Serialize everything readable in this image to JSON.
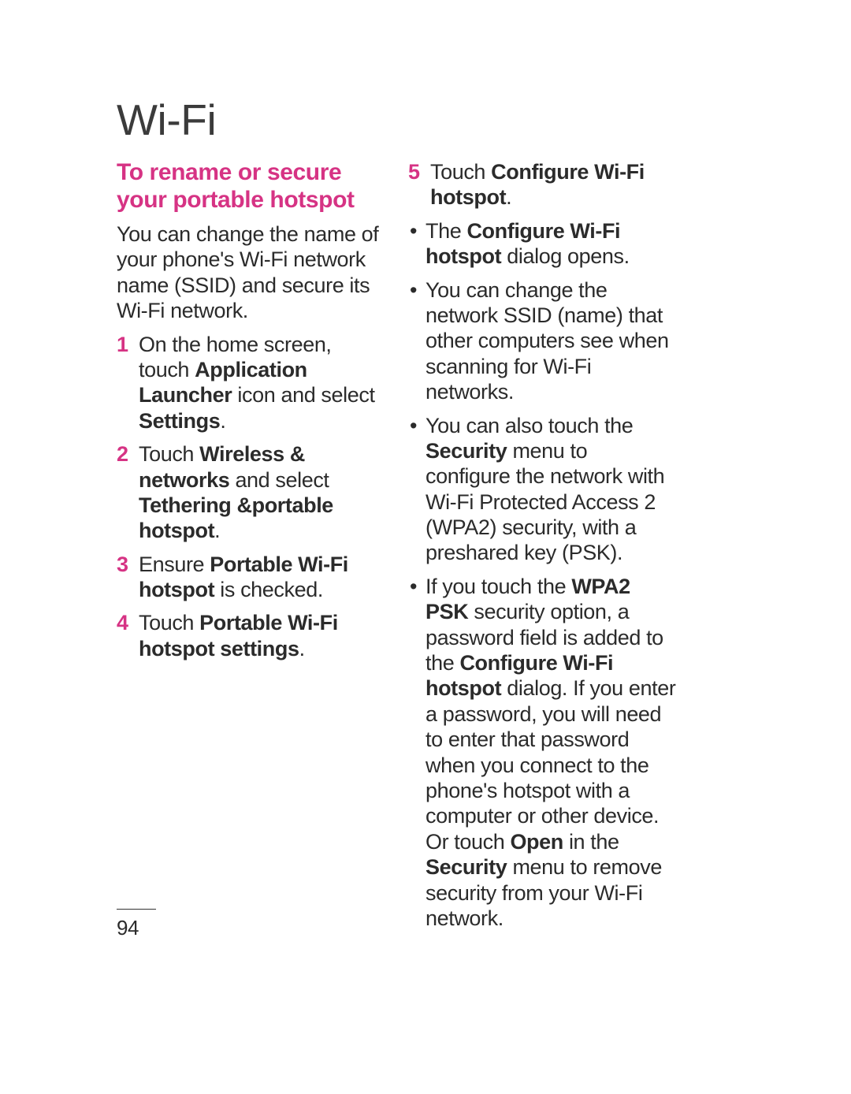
{
  "title": "Wi-Fi",
  "section_heading": "To rename or secure your portable hotspot",
  "intro": "You can change the name of your phone's Wi-Fi network name (SSID) and secure its Wi-Fi network.",
  "steps": {
    "s1": {
      "num": "1",
      "t1": "On the home screen, touch ",
      "b1": "Application Launcher",
      "t2": " icon and select ",
      "b2": "Settings",
      "t3": "."
    },
    "s2": {
      "num": "2",
      "t1": "Touch ",
      "b1": "Wireless & networks",
      "t2": " and select ",
      "b2": "Tethering &portable hotspot",
      "t3": "."
    },
    "s3": {
      "num": "3",
      "t1": "Ensure ",
      "b1": "Portable Wi-Fi hotspot",
      "t2": " is checked."
    },
    "s4": {
      "num": "4",
      "t1": "Touch ",
      "b1": "Portable Wi-Fi hotspot settings",
      "t2": "."
    },
    "s5": {
      "num": "5",
      "t1": "Touch ",
      "b1": "Configure Wi-Fi hotspot",
      "t2": "."
    }
  },
  "bullets": {
    "b1": {
      "t1": "The ",
      "b1": "Configure Wi-Fi hotspot",
      "t2": " dialog opens."
    },
    "b2": {
      "t1": "You can change the network SSID (name) that other computers see when scanning for Wi-Fi networks."
    },
    "b3": {
      "t1": "You can also touch the ",
      "b1": "Security",
      "t2": " menu to configure the network with Wi-Fi Protected Access 2 (WPA2) security, with a preshared key (PSK)."
    },
    "b4": {
      "t1": "If you touch the ",
      "b1": "WPA2 PSK",
      "t2": " security option, a password field is added to the ",
      "b2": "Configure Wi-Fi hotspot",
      "t3": " dialog. If you enter a password, you will need to enter that password when you connect to the phone's hotspot with a computer or other device. Or touch ",
      "b3": "Open",
      "t4": " in the ",
      "b4": "Security",
      "t5": " menu to remove security from your Wi-Fi network."
    }
  },
  "page_number": "94"
}
